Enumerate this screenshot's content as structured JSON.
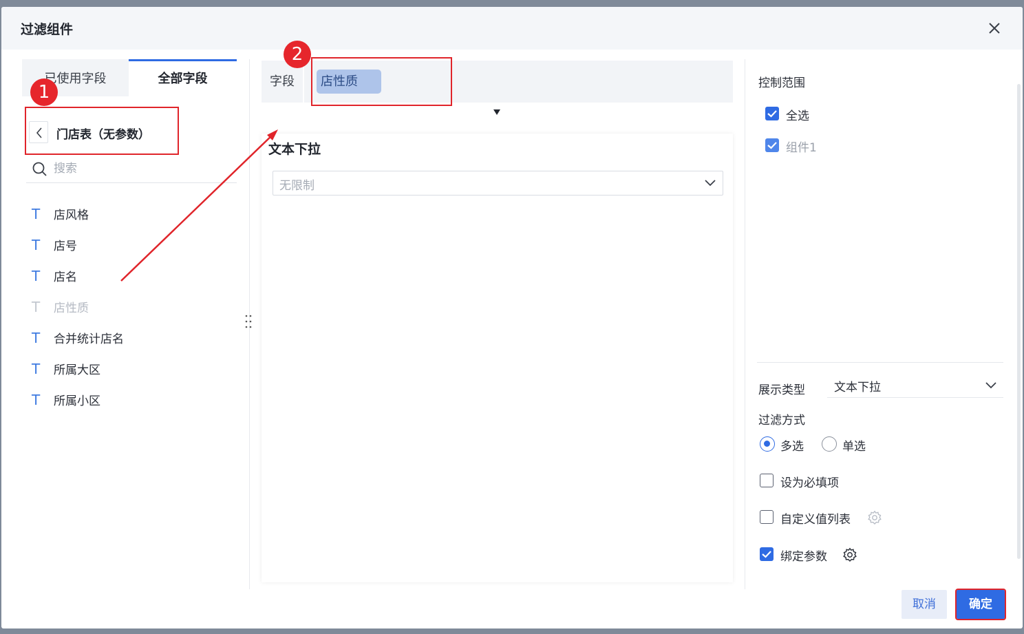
{
  "dialog": {
    "title": "过滤组件"
  },
  "left": {
    "tabs": [
      "已使用字段",
      "全部字段"
    ],
    "table_name": "门店表（无参数）",
    "search_placeholder": "搜索",
    "fields": [
      {
        "label": "店风格",
        "type_icon": "T",
        "disabled": false
      },
      {
        "label": "店号",
        "type_icon": "T",
        "disabled": false
      },
      {
        "label": "店名",
        "type_icon": "T",
        "disabled": false
      },
      {
        "label": "店性质",
        "type_icon": "T",
        "disabled": true
      },
      {
        "label": "合并统计店名",
        "type_icon": "T",
        "disabled": false
      },
      {
        "label": "所属大区",
        "type_icon": "T",
        "disabled": false
      },
      {
        "label": "所属小区",
        "type_icon": "T",
        "disabled": false
      }
    ]
  },
  "middle": {
    "field_label": "字段",
    "selected_field": "店性质",
    "preview_title": "文本下拉",
    "select_placeholder": "无限制"
  },
  "right": {
    "control_scope_label": "控制范围",
    "scope_items": [
      {
        "label": "全选",
        "checked": true
      },
      {
        "label": "组件1",
        "checked": true
      }
    ],
    "display_type_label": "展示类型",
    "display_type_value": "文本下拉",
    "filter_mode_label": "过滤方式",
    "filter_modes": [
      {
        "label": "多选",
        "selected": true
      },
      {
        "label": "单选",
        "selected": false
      }
    ],
    "options": [
      {
        "label": "设为必填项",
        "checked": false,
        "gear": false
      },
      {
        "label": "自定义值列表",
        "checked": false,
        "gear": true
      },
      {
        "label": "绑定参数",
        "checked": true,
        "gear": true
      }
    ]
  },
  "footer": {
    "cancel_label": "取消",
    "ok_label": "确定"
  },
  "annotations": [
    "1",
    "2"
  ],
  "colors": {
    "primary": "#2f6be3",
    "annotation_red": "#e0242a",
    "chip_bg": "#aec4ea",
    "overlay": "#7f8a99"
  }
}
